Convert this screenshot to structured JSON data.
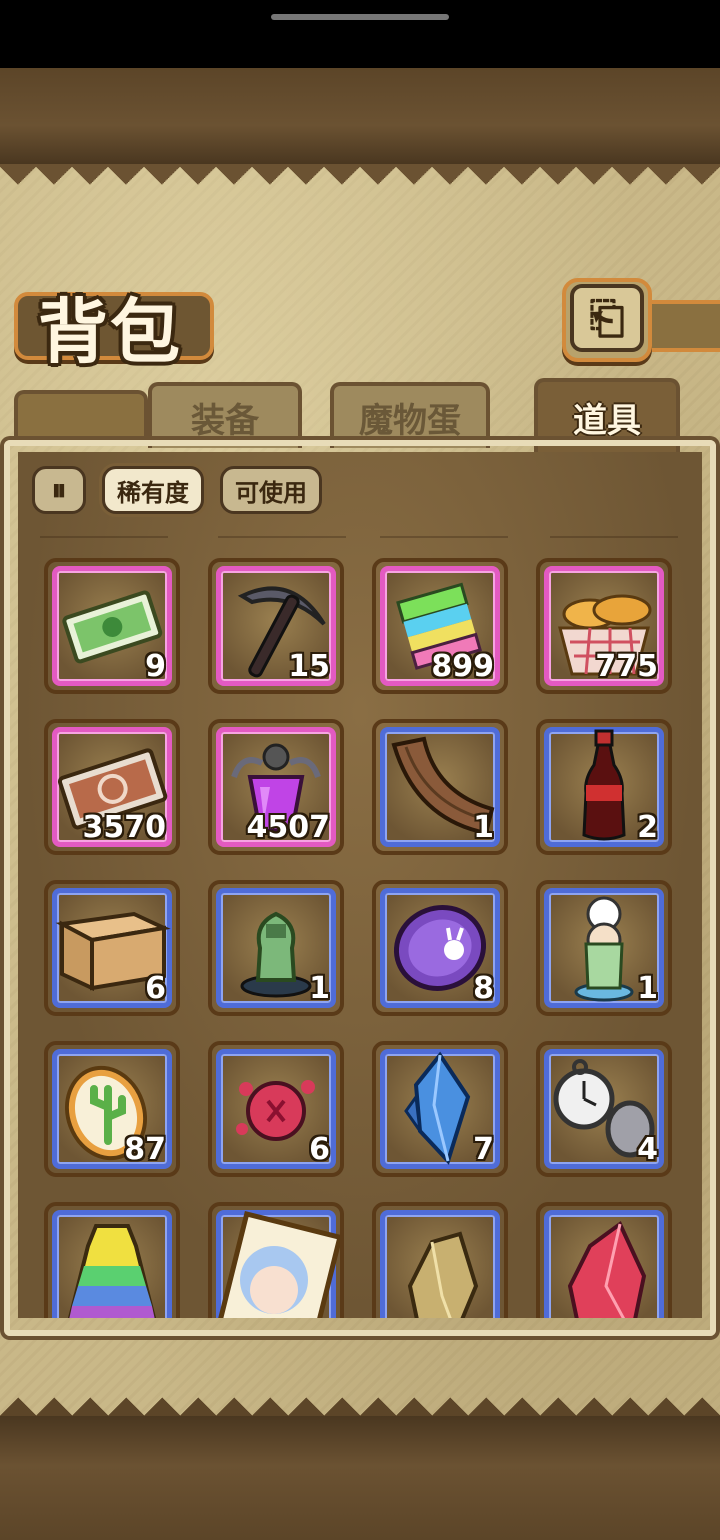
{
  "header": {
    "title": "背包"
  },
  "tabs": [
    {
      "label": "装备",
      "active": false
    },
    {
      "label": "魔物蛋",
      "active": false
    },
    {
      "label": "道具",
      "active": true
    }
  ],
  "filters": {
    "sort_icon": "sort-toggle-icon",
    "rarity_label": "稀有度",
    "usable_label": "可使用"
  },
  "items": [
    {
      "name": "green-ticket",
      "rarity": "pink",
      "qty": "9"
    },
    {
      "name": "pickaxe",
      "rarity": "pink",
      "qty": "15"
    },
    {
      "name": "rainbow-block",
      "rarity": "pink",
      "qty": "899"
    },
    {
      "name": "bread-basket",
      "rarity": "pink",
      "qty": "775"
    },
    {
      "name": "brown-ticket",
      "rarity": "pink",
      "qty": "3570"
    },
    {
      "name": "purple-potion",
      "rarity": "pink",
      "qty": "4507"
    },
    {
      "name": "wood-plank",
      "rarity": "blue",
      "qty": "1"
    },
    {
      "name": "cola-bottle",
      "rarity": "blue",
      "qty": "2"
    },
    {
      "name": "cardboard-box",
      "rarity": "blue",
      "qty": "6"
    },
    {
      "name": "knight-figurine",
      "rarity": "blue",
      "qty": "1"
    },
    {
      "name": "bunny-coin",
      "rarity": "blue",
      "qty": "8"
    },
    {
      "name": "chef-figurine",
      "rarity": "blue",
      "qty": "1"
    },
    {
      "name": "cactus-cookie",
      "rarity": "blue",
      "qty": "87"
    },
    {
      "name": "red-slime-ball",
      "rarity": "blue",
      "qty": "6"
    },
    {
      "name": "blue-crystal",
      "rarity": "blue",
      "qty": "7"
    },
    {
      "name": "pocket-watch",
      "rarity": "blue",
      "qty": "4"
    },
    {
      "name": "rainbow-dress",
      "rarity": "blue",
      "qty": ""
    },
    {
      "name": "girl-portrait",
      "rarity": "blue",
      "qty": ""
    },
    {
      "name": "gold-crystal",
      "rarity": "blue",
      "qty": ""
    },
    {
      "name": "red-crystal",
      "rarity": "blue",
      "qty": ""
    }
  ]
}
